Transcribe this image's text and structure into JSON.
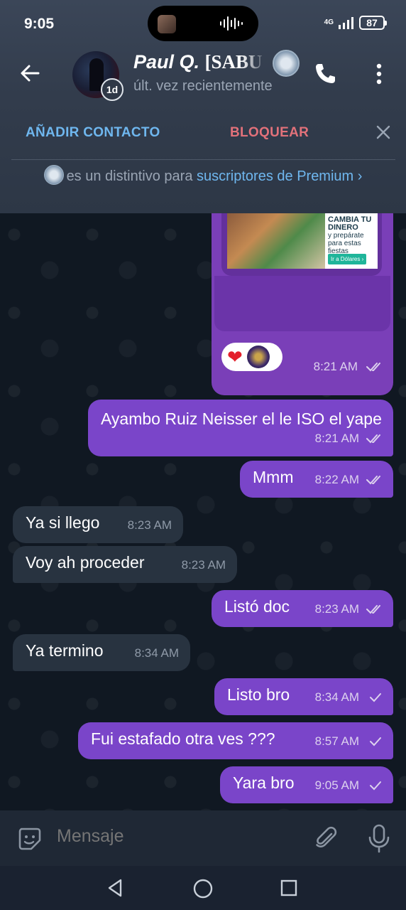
{
  "status_bar": {
    "time": "9:05",
    "network": "4G",
    "battery": "87"
  },
  "header": {
    "contact_name": "Paul Q.",
    "contact_tag": "[SABU",
    "last_seen": "últ. vez recientemente",
    "avatar_badge": "1d"
  },
  "actions": {
    "add_contact": "AÑADIR CONTACTO",
    "block": "BLOQUEAR"
  },
  "premium_note": {
    "text": "es un distintivo para",
    "link": "suscriptores de Premium",
    "chevron": "›"
  },
  "media_message": {
    "ad_title": "CAMBIA TU DINERO",
    "ad_subtitle": "y prepárate para estas fiestas",
    "ad_button": "Ir a Dólares ›",
    "reaction": "❤",
    "time": "8:21 AM",
    "status": "read"
  },
  "messages": [
    {
      "direction": "out",
      "text": "Ayambo Ruiz Neisser el le ISO el yape",
      "time": "8:21 AM",
      "status": "read"
    },
    {
      "direction": "out",
      "text": "Mmm",
      "time": "8:22 AM",
      "status": "read"
    },
    {
      "direction": "in",
      "text": "Ya si llego",
      "time": "8:23 AM"
    },
    {
      "direction": "in",
      "text": "Voy ah proceder",
      "time": "8:23 AM"
    },
    {
      "direction": "out",
      "text": "Listó doc",
      "time": "8:23 AM",
      "status": "read"
    },
    {
      "direction": "in",
      "text": "Ya termino",
      "time": "8:34 AM"
    },
    {
      "direction": "out",
      "text": "Listo bro",
      "time": "8:34 AM",
      "status": "sent"
    },
    {
      "direction": "out",
      "text": "Fui estafado otra ves ???",
      "time": "8:57 AM",
      "status": "sent"
    },
    {
      "direction": "out",
      "text": "Yara bro",
      "time": "9:05 AM",
      "status": "sent"
    }
  ],
  "input": {
    "placeholder": "Mensaje"
  },
  "colors": {
    "outgoing_bubble": "#7a45c9",
    "incoming_bubble": "#283340",
    "link": "#6fb7ef",
    "danger": "#e2717a"
  }
}
